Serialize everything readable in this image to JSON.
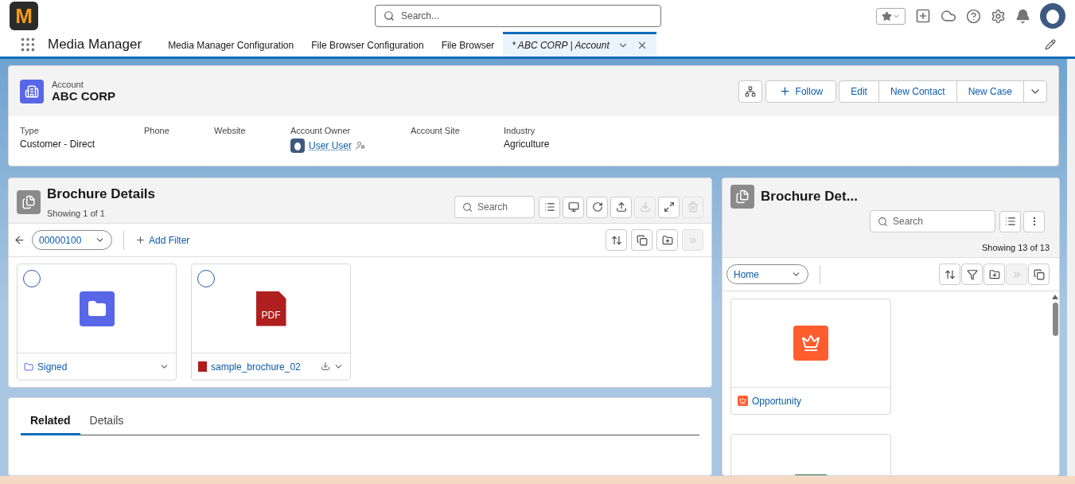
{
  "logo": {
    "letter": "M"
  },
  "global_search": {
    "placeholder": "Search..."
  },
  "nav": {
    "app_name": "Media Manager",
    "tabs": [
      {
        "label": "Media Manager Configuration",
        "selected": false
      },
      {
        "label": "File Browser Configuration",
        "selected": false
      },
      {
        "label": "File Browser",
        "selected": false
      },
      {
        "label": "* ABC CORP | Account",
        "selected": true
      }
    ]
  },
  "record": {
    "object": "Account",
    "name": "ABC CORP",
    "actions": [
      "Follow",
      "Edit",
      "New Contact",
      "New Case"
    ],
    "fields": [
      {
        "label": "Type",
        "value": "Customer - Direct",
        "kind": "text"
      },
      {
        "label": "Phone",
        "kind": "text"
      },
      {
        "label": "Website",
        "kind": "text"
      },
      {
        "label": "Account Owner",
        "value": "User User",
        "kind": "user"
      },
      {
        "label": "Account Site",
        "kind": "text"
      },
      {
        "label": "Industry",
        "value": "Agriculture",
        "kind": "text"
      }
    ]
  },
  "left_panel": {
    "title": "Brochure Details",
    "showing": "Showing 1 of 1",
    "search": {
      "placeholder": "Search"
    },
    "tools": [
      {
        "kind": "list",
        "disabled": false
      },
      {
        "kind": "tile",
        "disabled": false
      },
      {
        "kind": "refresh",
        "disabled": false
      },
      {
        "kind": "upload",
        "disabled": false
      },
      {
        "kind": "download",
        "disabled": true
      },
      {
        "kind": "expand",
        "disabled": false
      },
      {
        "kind": "delete",
        "disabled": true
      }
    ],
    "folder": "00000100",
    "add_filter": "Add Filter",
    "actions": [
      {
        "kind": "sort",
        "disabled": false
      },
      {
        "kind": "copy",
        "disabled": false
      },
      {
        "kind": "new-folder",
        "disabled": false
      },
      {
        "kind": "move",
        "disabled": true
      }
    ],
    "items": [
      {
        "name": "Signed",
        "kind": "folder",
        "selected": false
      },
      {
        "name": "sample_brochure_02",
        "kind": "pdf",
        "badge": "PDF",
        "selected": false
      }
    ]
  },
  "bottom_tabs": [
    {
      "label": "Related",
      "selected": true
    },
    {
      "label": "Details",
      "selected": false
    }
  ],
  "right_panel": {
    "title": "Brochure Det...",
    "search": {
      "placeholder": "Search"
    },
    "showing": "Showing 13 of 13",
    "folder": "Home",
    "actions": [
      {
        "kind": "sort",
        "disabled": false
      },
      {
        "kind": "filter",
        "disabled": false
      },
      {
        "kind": "new-folder",
        "disabled": false
      },
      {
        "kind": "move",
        "disabled": true
      },
      {
        "kind": "copy",
        "disabled": false
      }
    ],
    "items": [
      {
        "name": "Opportunity",
        "kind": "opportunity"
      },
      {
        "kind": "sheet"
      }
    ]
  }
}
